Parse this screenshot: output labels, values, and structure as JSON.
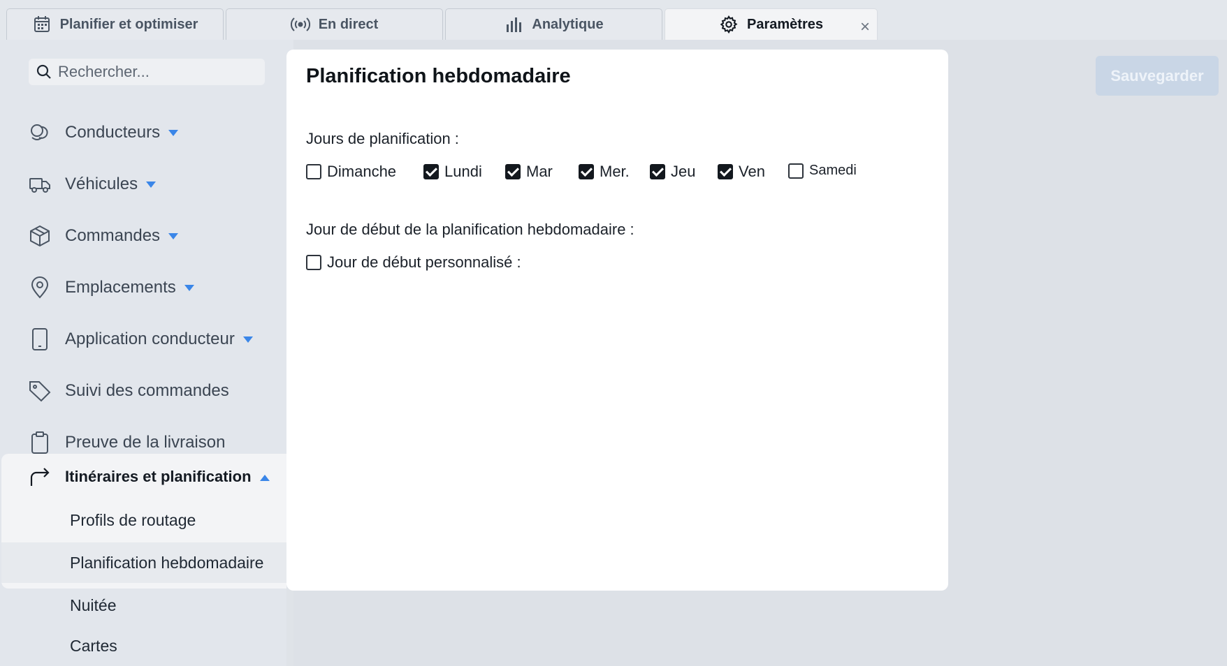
{
  "tabs": [
    {
      "label": "Planifier et optimiser",
      "icon": "calendar-icon"
    },
    {
      "label": "En direct",
      "icon": "broadcast-icon"
    },
    {
      "label": "Analytique",
      "icon": "bar-chart-icon"
    },
    {
      "label": "Paramètres",
      "icon": "gear-icon",
      "active": true,
      "close": "×"
    }
  ],
  "sidebar": {
    "search_placeholder": "Rechercher...",
    "items": [
      {
        "label": "Conducteurs",
        "icon": "drivers-icon"
      },
      {
        "label": "Véhicules",
        "icon": "truck-icon"
      },
      {
        "label": "Commandes",
        "icon": "package-icon"
      },
      {
        "label": "Emplacements",
        "icon": "location-pin-icon"
      },
      {
        "label": "Application conducteur",
        "icon": "phone-icon"
      },
      {
        "label": "Suivi des commandes",
        "icon": "tag-icon"
      },
      {
        "label": "Preuve de la livraison",
        "icon": "clipboard-icon"
      }
    ],
    "group": {
      "label": "Itinéraires et planification",
      "icon": "route-arrow-icon",
      "sub_items": [
        "Profils de routage",
        "Planification hebdomadaire",
        "Nuitée",
        "Cartes"
      ],
      "selected": "Planification hebdomadaire"
    }
  },
  "panel": {
    "title": "Planification hebdomadaire",
    "days_label": "Jours de planification :",
    "days": [
      {
        "label": "Dimanche",
        "checked": false
      },
      {
        "label": "Lundi",
        "checked": true
      },
      {
        "label": "Mar",
        "checked": true
      },
      {
        "label": "Mer.",
        "checked": true
      },
      {
        "label": "Jeu",
        "checked": true
      },
      {
        "label": "Ven",
        "checked": true
      },
      {
        "label": "Samedi",
        "checked": false
      }
    ],
    "start_day_label": "Jour de début de la planification hebdomadaire :",
    "custom_start_label": "Jour de début personnalisé :",
    "custom_start_checked": false
  },
  "actions": {
    "save_label": "Sauvegarder"
  },
  "colors": {
    "accent": "#3a86e8",
    "save_disabled": "#c9d6e6"
  }
}
